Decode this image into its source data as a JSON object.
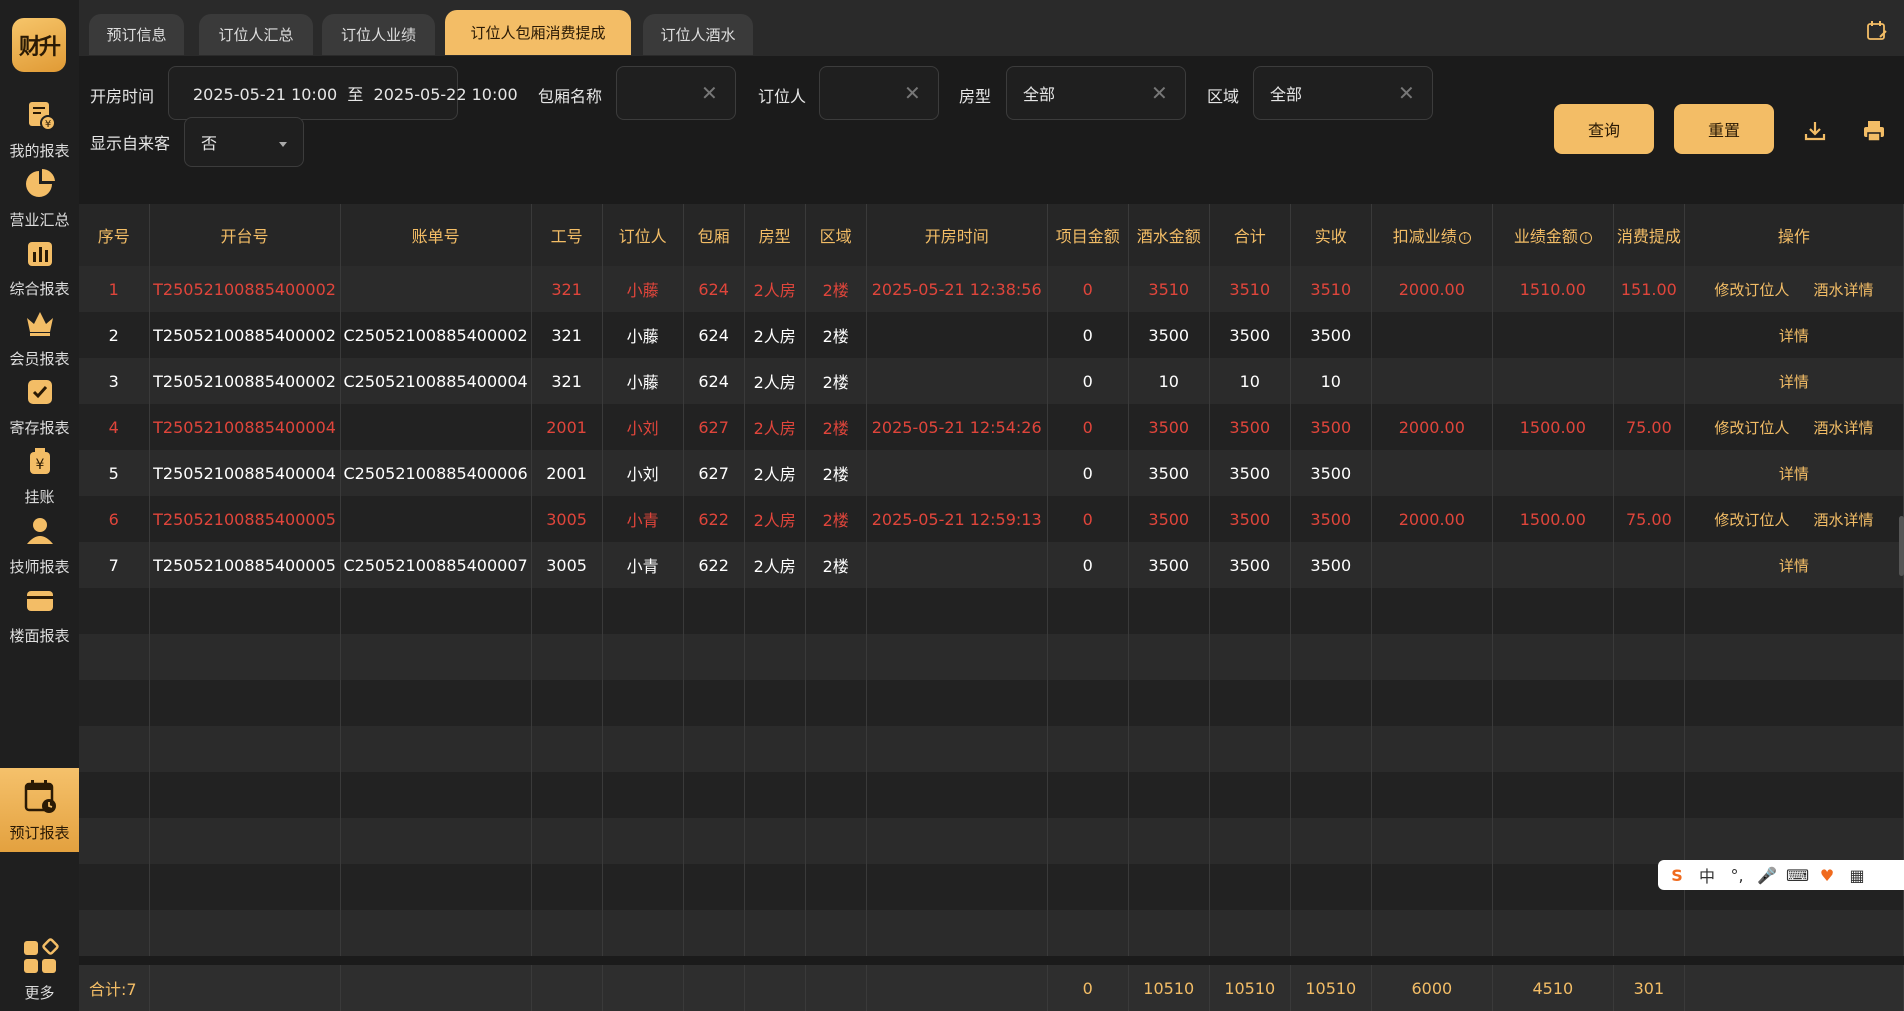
{
  "logo": {
    "text": "财升"
  },
  "sidebar": {
    "items": [
      {
        "label": "我的报表",
        "icon": "report-doc-icon"
      },
      {
        "label": "营业汇总",
        "icon": "pie-chart-icon"
      },
      {
        "label": "综合报表",
        "icon": "bar-chart-icon"
      },
      {
        "label": "会员报表",
        "icon": "crown-icon"
      },
      {
        "label": "寄存报表",
        "icon": "checkbox-icon"
      },
      {
        "label": "挂账",
        "icon": "yen-bag-icon"
      },
      {
        "label": "技师报表",
        "icon": "user-icon"
      },
      {
        "label": "楼面报表",
        "icon": "card-icon"
      },
      {
        "label": "预订报表",
        "icon": "calendar-clock-icon",
        "active": true
      }
    ],
    "more": {
      "label": "更多",
      "icon": "grid-icon"
    }
  },
  "tabs": [
    {
      "label": "预订信息"
    },
    {
      "label": "订位人汇总"
    },
    {
      "label": "订位人业绩"
    },
    {
      "label": "订位人包厢消费提成",
      "active": true
    },
    {
      "label": "订位人酒水"
    }
  ],
  "filters": {
    "open_time_label": "开房时间",
    "open_time_value": "2025-05-21 10:00  至  2025-05-22 10:00",
    "room_name_label": "包厢名称",
    "room_name_value": "",
    "booker_label": "订位人",
    "booker_value": "",
    "room_type_label": "房型",
    "room_type_value": "全部",
    "area_label": "区域",
    "area_value": "全部",
    "walkin_label": "显示自来客",
    "walkin_value": "否",
    "query_label": "查询",
    "reset_label": "重置"
  },
  "table": {
    "headers": [
      "序号",
      "开台号",
      "账单号",
      "工号",
      "订位人",
      "包厢",
      "房型",
      "区域",
      "开房时间",
      "项目金额",
      "酒水金额",
      "合计",
      "实收",
      "扣减业绩",
      "业绩金额",
      "消费提成",
      "操作"
    ],
    "rows": [
      {
        "style": "red",
        "cells": [
          "1",
          "T25052100885400002",
          "",
          "321",
          "小藤",
          "624",
          "2人房",
          "2楼",
          "2025-05-21 12:38:56",
          "0",
          "3510",
          "3510",
          "3510",
          "2000.00",
          "1510.00",
          "151.00"
        ],
        "ops": [
          "修改订位人",
          "酒水详情"
        ]
      },
      {
        "style": "white",
        "cells": [
          "2",
          "T25052100885400002",
          "C25052100885400002",
          "321",
          "小藤",
          "624",
          "2人房",
          "2楼",
          "",
          "0",
          "3500",
          "3500",
          "3500",
          "",
          "",
          ""
        ],
        "ops": [
          "详情"
        ]
      },
      {
        "style": "white",
        "cells": [
          "3",
          "T25052100885400002",
          "C25052100885400004",
          "321",
          "小藤",
          "624",
          "2人房",
          "2楼",
          "",
          "0",
          "10",
          "10",
          "10",
          "",
          "",
          ""
        ],
        "ops": [
          "详情"
        ]
      },
      {
        "style": "red",
        "cells": [
          "4",
          "T25052100885400004",
          "",
          "2001",
          "小刘",
          "627",
          "2人房",
          "2楼",
          "2025-05-21 12:54:26",
          "0",
          "3500",
          "3500",
          "3500",
          "2000.00",
          "1500.00",
          "75.00"
        ],
        "ops": [
          "修改订位人",
          "酒水详情"
        ]
      },
      {
        "style": "white",
        "cells": [
          "5",
          "T25052100885400004",
          "C25052100885400006",
          "2001",
          "小刘",
          "627",
          "2人房",
          "2楼",
          "",
          "0",
          "3500",
          "3500",
          "3500",
          "",
          "",
          ""
        ],
        "ops": [
          "详情"
        ]
      },
      {
        "style": "red",
        "cells": [
          "6",
          "T25052100885400005",
          "",
          "3005",
          "小青",
          "622",
          "2人房",
          "2楼",
          "2025-05-21 12:59:13",
          "0",
          "3500",
          "3500",
          "3500",
          "2000.00",
          "1500.00",
          "75.00"
        ],
        "ops": [
          "修改订位人",
          "酒水详情"
        ]
      },
      {
        "style": "white",
        "cells": [
          "7",
          "T25052100885400005",
          "C25052100885400007",
          "3005",
          "小青",
          "622",
          "2人房",
          "2楼",
          "",
          "0",
          "3500",
          "3500",
          "3500",
          "",
          "",
          ""
        ],
        "ops": [
          "详情"
        ]
      }
    ],
    "footer": [
      "合计:7",
      "",
      "",
      "",
      "",
      "",
      "",
      "",
      "",
      "0",
      "10510",
      "10510",
      "10510",
      "6000",
      "4510",
      "301",
      ""
    ]
  },
  "ime": {
    "lang": "中"
  },
  "colors": {
    "accent": "#f3bd66",
    "red_row": "#e0453b"
  }
}
